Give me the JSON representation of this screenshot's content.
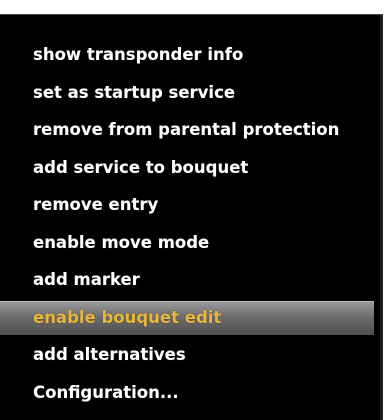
{
  "context_menu": {
    "items": [
      {
        "label": "show transponder info"
      },
      {
        "label": "set as startup service"
      },
      {
        "label": "remove from parental protection"
      },
      {
        "label": "add service to bouquet"
      },
      {
        "label": "remove entry"
      },
      {
        "label": "enable move mode"
      },
      {
        "label": "add marker"
      },
      {
        "label": "enable bouquet edit",
        "selected": true
      },
      {
        "label": "add alternatives"
      },
      {
        "label": "Configuration..."
      }
    ],
    "colors": {
      "background": "#000000",
      "text": "#ffffff",
      "selected_text": "#e8b63a",
      "selected_bar": "#6d6d6d"
    }
  }
}
